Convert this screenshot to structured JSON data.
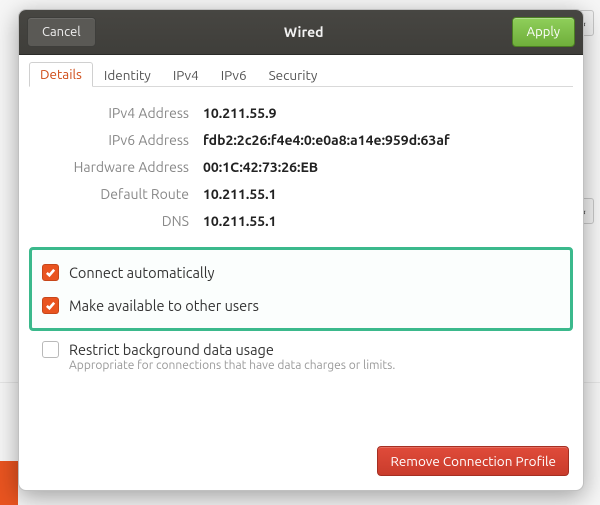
{
  "titlebar": {
    "cancel": "Cancel",
    "title": "Wired",
    "apply": "Apply"
  },
  "tabs": [
    {
      "label": "Details",
      "active": true
    },
    {
      "label": "Identity",
      "active": false
    },
    {
      "label": "IPv4",
      "active": false
    },
    {
      "label": "IPv6",
      "active": false
    },
    {
      "label": "Security",
      "active": false
    }
  ],
  "details": {
    "ipv4_label": "IPv4 Address",
    "ipv4_value": "10.211.55.9",
    "ipv6_label": "IPv6 Address",
    "ipv6_value": "fdb2:2c26:f4e4:0:e0a8:a14e:959d:63af",
    "hw_label": "Hardware Address",
    "hw_value": "00:1C:42:73:26:EB",
    "route_label": "Default Route",
    "route_value": "10.211.55.1",
    "dns_label": "DNS",
    "dns_value": "10.211.55.1"
  },
  "options": {
    "connect_auto": {
      "label": "Connect automatically",
      "checked": true
    },
    "available_others": {
      "label": "Make available to other users",
      "checked": true
    },
    "restrict": {
      "label": "Restrict background data usage",
      "sub": "Appropriate for connections that have data charges or limits.",
      "checked": false
    }
  },
  "remove_button": "Remove Connection Profile"
}
